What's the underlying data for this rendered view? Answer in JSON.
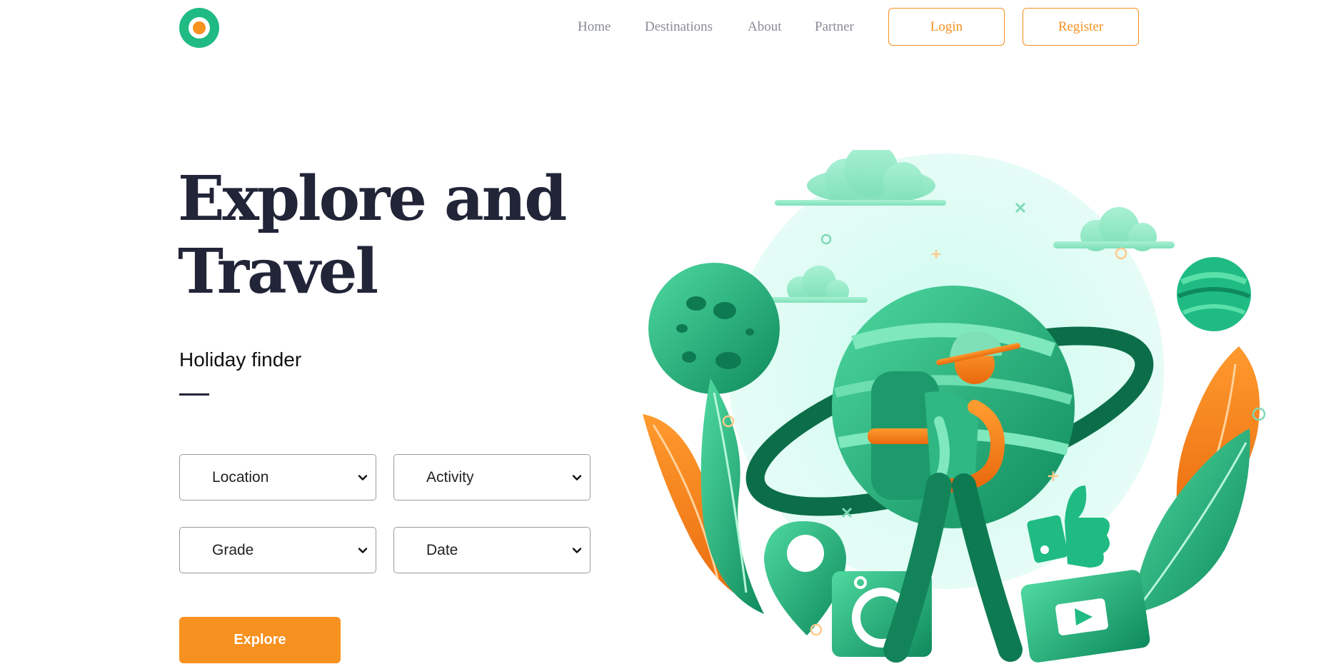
{
  "nav": {
    "logo_icon": "logo-ring-icon",
    "links": [
      "Home",
      "Destinations",
      "About",
      "Partner"
    ],
    "login_label": "Login",
    "register_label": "Register"
  },
  "hero": {
    "title_line1": "Explore and",
    "title_line2": "Travel"
  },
  "finder": {
    "heading": "Holiday finder",
    "selects": [
      {
        "selected": "Location"
      },
      {
        "selected": "Activity"
      },
      {
        "selected": "Grade"
      },
      {
        "selected": "Date"
      }
    ],
    "explore_label": "Explore"
  },
  "colors": {
    "accent_orange": "#f7911f",
    "brand_green": "#1fbb83",
    "heading_dark": "#222538",
    "nav_gray": "#8a8c99"
  },
  "illustration": {
    "name": "traveler-planet-illustration"
  }
}
